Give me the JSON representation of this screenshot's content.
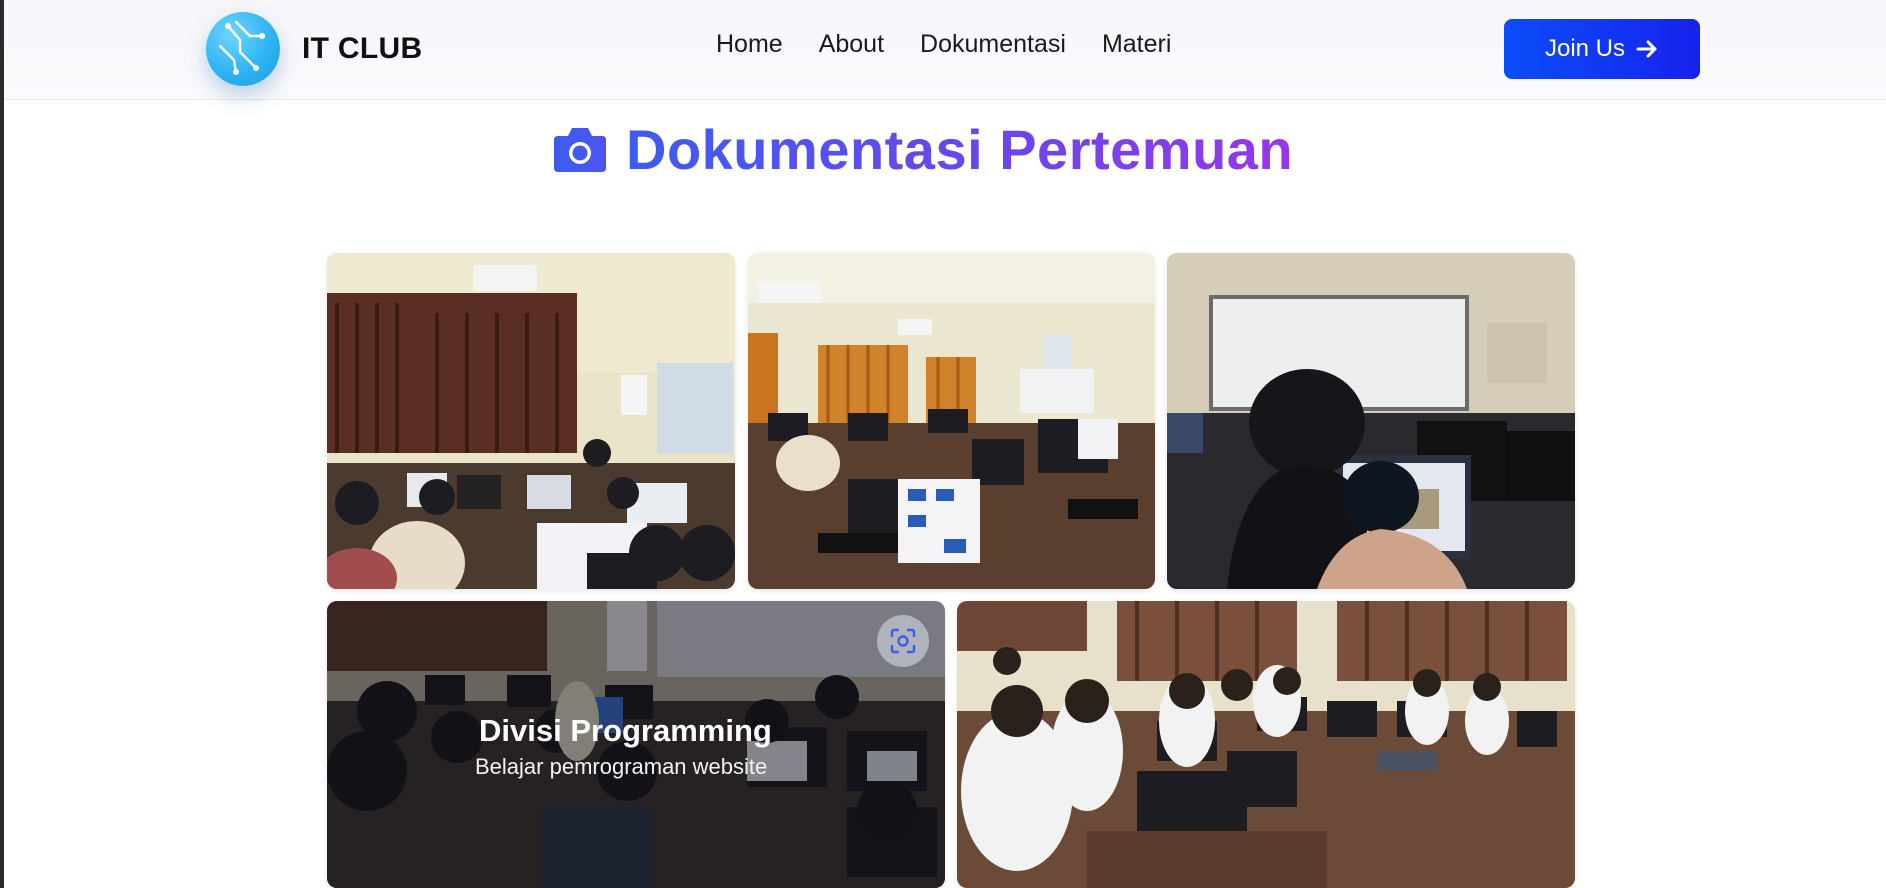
{
  "navbar": {
    "brand_name": "IT CLUB",
    "links": [
      "Home",
      "About",
      "Dokumentasi",
      "Materi"
    ],
    "cta_label": "Join Us"
  },
  "section": {
    "title": "Dokumentasi Pertemuan",
    "icon": "camera-icon"
  },
  "gallery": {
    "items": [
      {
        "title": "",
        "subtitle": ""
      },
      {
        "title": "",
        "subtitle": ""
      },
      {
        "title": "",
        "subtitle": ""
      },
      {
        "title": "Divisi Programming",
        "subtitle": "Belajar pemrograman website"
      },
      {
        "title": "",
        "subtitle": ""
      }
    ]
  },
  "colors": {
    "accent_blue": "#0c4dfa",
    "title_gradient_start": "#3d5cf0",
    "title_gradient_end": "#9637ea",
    "logo_blue": "#2eb3f3"
  }
}
